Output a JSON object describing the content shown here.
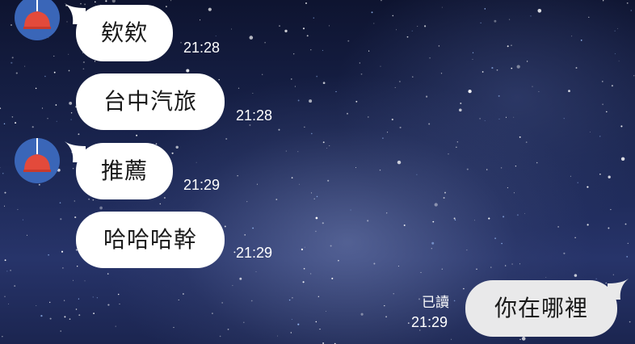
{
  "chat": {
    "messages": [
      {
        "direction": "received",
        "text": "欸欸",
        "time": "21:28",
        "show_avatar": true
      },
      {
        "direction": "received",
        "text": "台中汽旅",
        "time": "21:28",
        "show_avatar": false
      },
      {
        "direction": "received",
        "text": "推薦",
        "time": "21:29",
        "show_avatar": true
      },
      {
        "direction": "received",
        "text": "哈哈哈幹",
        "time": "21:29",
        "show_avatar": false
      },
      {
        "direction": "sent",
        "text": "你在哪裡",
        "time": "21:29",
        "read_status": "已讀"
      }
    ],
    "avatar": {
      "icon": "lamp-icon",
      "background_color": "#3a66b8",
      "icon_color": "#e34a3b"
    },
    "colors": {
      "received_bubble": "#ffffff",
      "sent_bubble": "#e9e9ea",
      "meta_text": "#ffffff"
    }
  }
}
